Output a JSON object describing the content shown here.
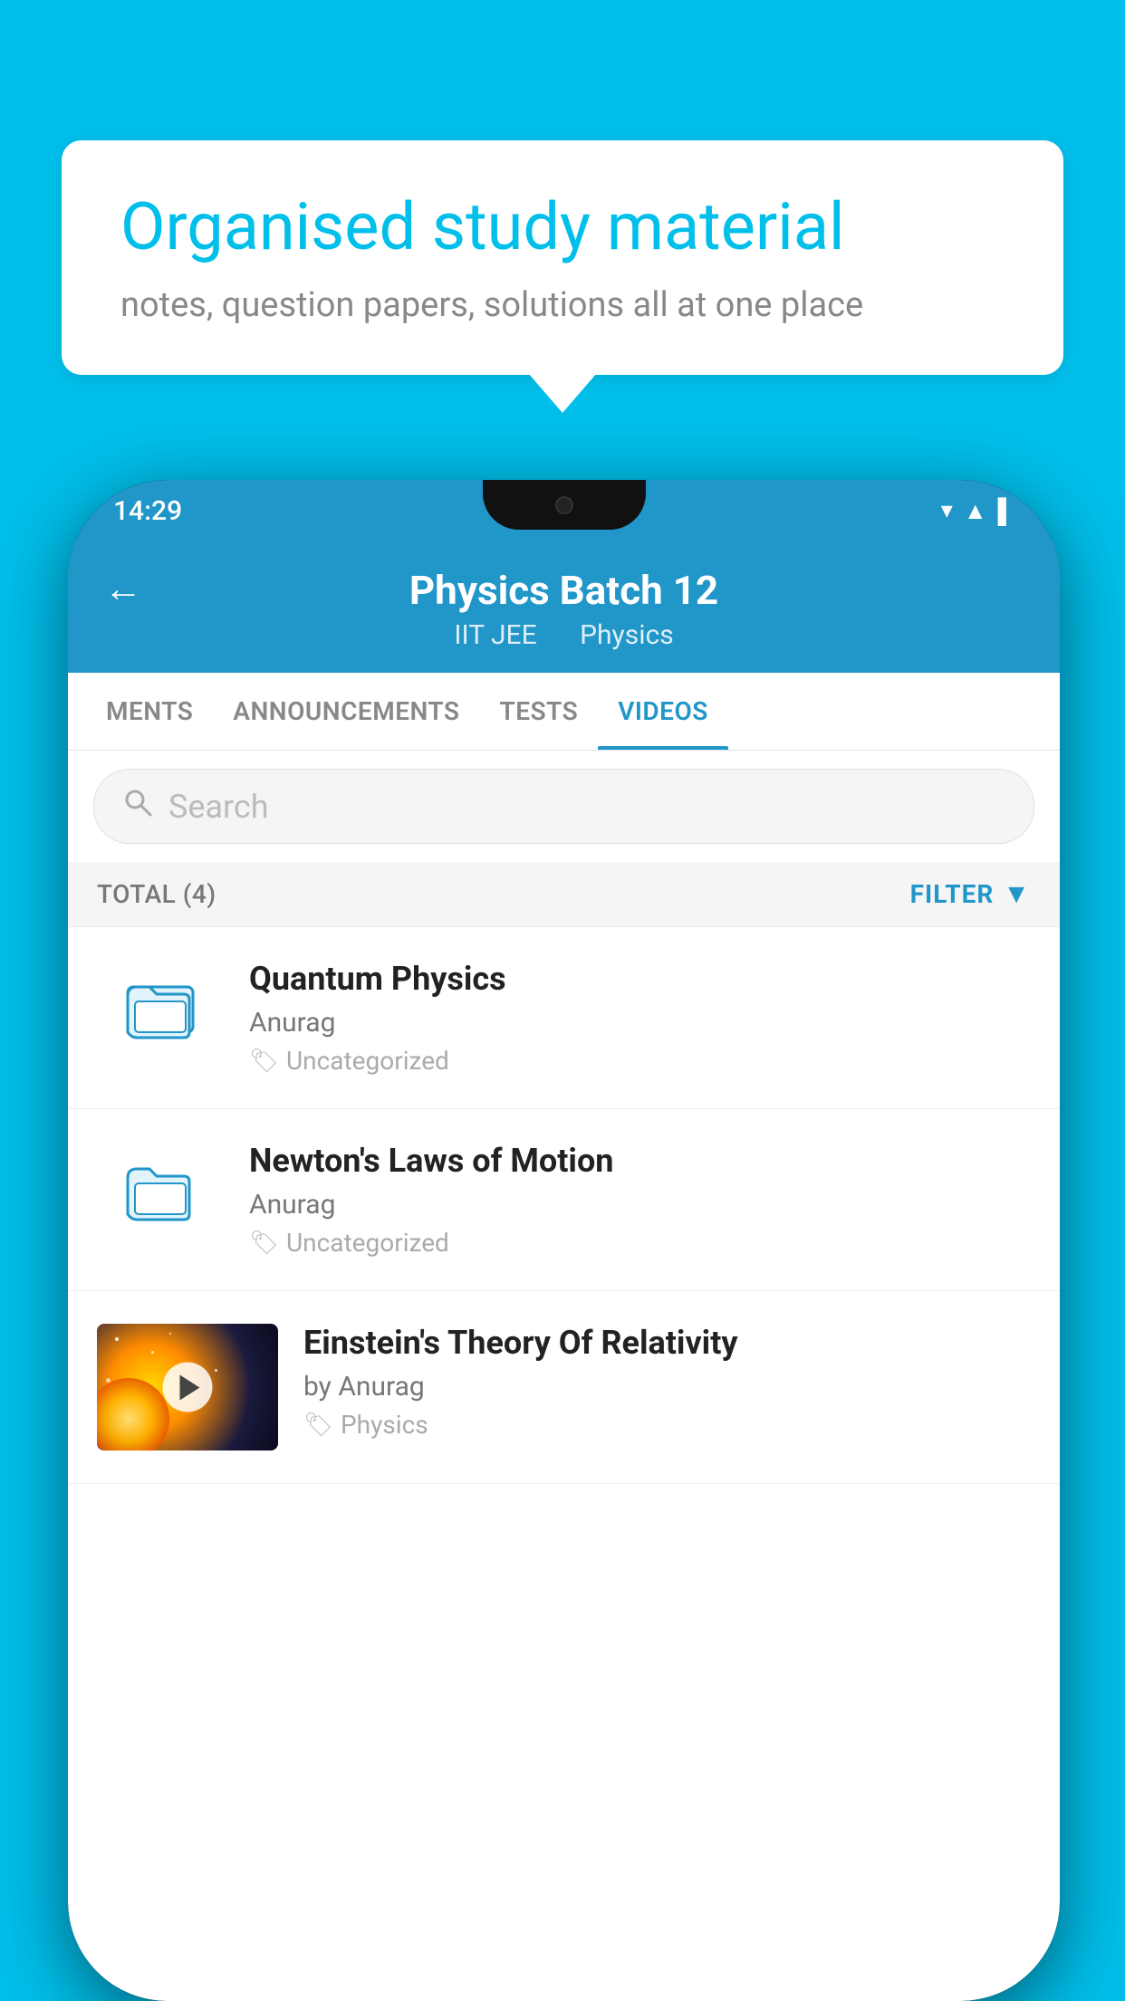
{
  "background_color": "#00BFEA",
  "speech_bubble": {
    "title": "Organised study material",
    "subtitle": "notes, question papers, solutions all at one place"
  },
  "phone": {
    "status_bar": {
      "time": "14:29",
      "icons": [
        "wifi",
        "signal",
        "battery"
      ]
    },
    "header": {
      "back_label": "←",
      "title": "Physics Batch 12",
      "subtitle_part1": "IIT JEE",
      "subtitle_part2": "Physics"
    },
    "tabs": [
      {
        "label": "MENTS",
        "active": false
      },
      {
        "label": "ANNOUNCEMENTS",
        "active": false
      },
      {
        "label": "TESTS",
        "active": false
      },
      {
        "label": "VIDEOS",
        "active": true
      }
    ],
    "search": {
      "placeholder": "Search"
    },
    "filter_bar": {
      "total_label": "TOTAL (4)",
      "filter_label": "FILTER"
    },
    "videos": [
      {
        "id": 1,
        "title": "Quantum Physics",
        "author": "Anurag",
        "tag": "Uncategorized",
        "has_thumb": false
      },
      {
        "id": 2,
        "title": "Newton's Laws of Motion",
        "author": "Anurag",
        "tag": "Uncategorized",
        "has_thumb": false
      },
      {
        "id": 3,
        "title": "Einstein's Theory Of Relativity",
        "author": "by Anurag",
        "tag": "Physics",
        "has_thumb": true
      }
    ]
  }
}
